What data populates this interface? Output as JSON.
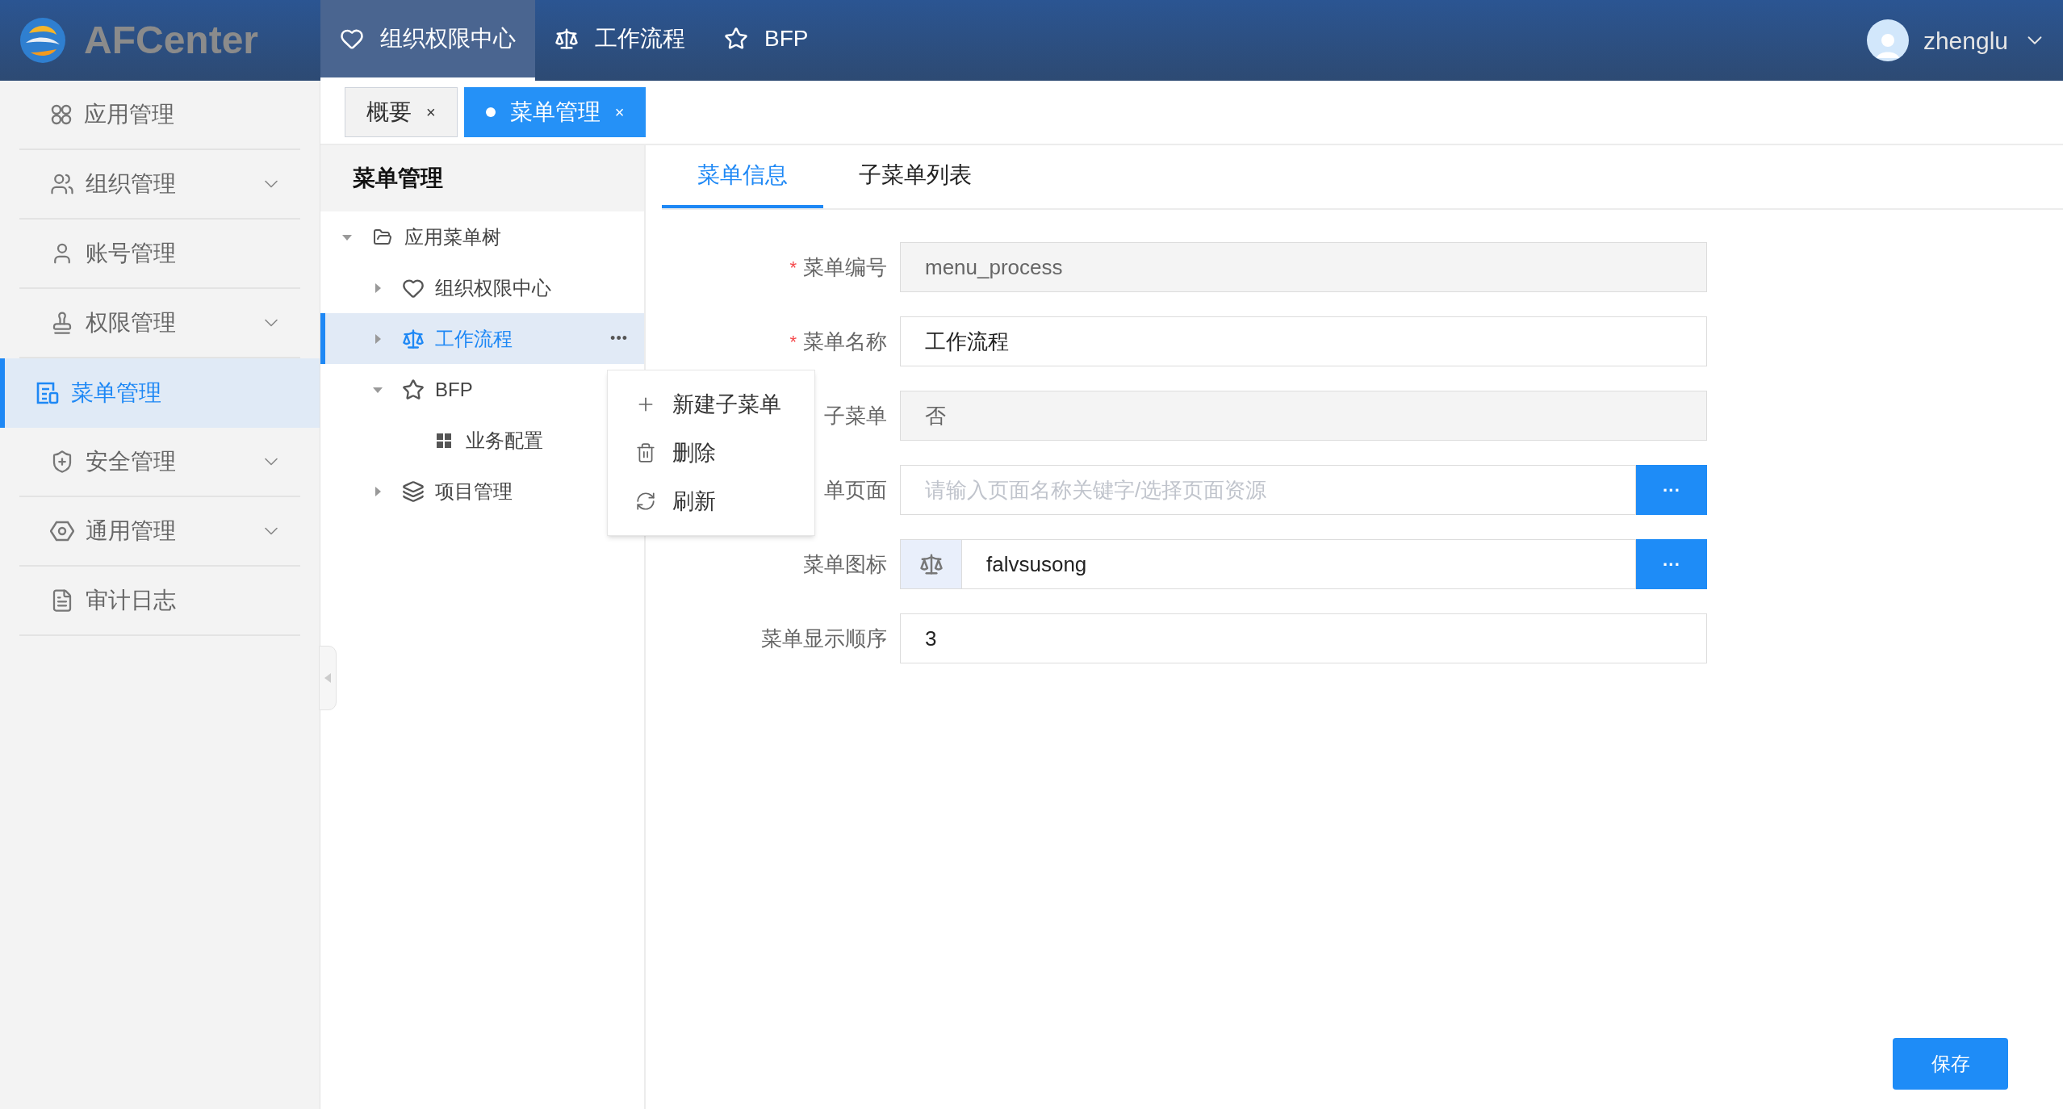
{
  "header": {
    "logo_text": "AFCenter",
    "nav": [
      {
        "label": "组织权限中心",
        "selected": true
      },
      {
        "label": "工作流程",
        "selected": false
      },
      {
        "label": "BFP",
        "selected": false
      }
    ],
    "user": {
      "name": "zhenglu"
    }
  },
  "sidebar": {
    "items": [
      {
        "label": "应用管理",
        "expandable": false,
        "selected": false
      },
      {
        "label": "组织管理",
        "expandable": true,
        "selected": false
      },
      {
        "label": "账号管理",
        "expandable": false,
        "selected": false
      },
      {
        "label": "权限管理",
        "expandable": true,
        "selected": false
      },
      {
        "label": "菜单管理",
        "expandable": false,
        "selected": true
      },
      {
        "label": "安全管理",
        "expandable": true,
        "selected": false
      },
      {
        "label": "通用管理",
        "expandable": true,
        "selected": false
      },
      {
        "label": "审计日志",
        "expandable": false,
        "selected": false
      }
    ]
  },
  "page_tabs": [
    {
      "label": "概要",
      "selected": false,
      "close": "×"
    },
    {
      "label": "菜单管理",
      "selected": true,
      "close": "×"
    }
  ],
  "tree": {
    "title": "菜单管理",
    "nodes": [
      {
        "label": "应用菜单树",
        "expanded": true,
        "selected": false,
        "children": [
          {
            "label": "组织权限中心",
            "expanded": false,
            "selected": false
          },
          {
            "label": "工作流程",
            "expanded": false,
            "selected": true,
            "more": "•••"
          },
          {
            "label": "BFP",
            "expanded": true,
            "selected": false,
            "children": [
              {
                "label": "业务配置",
                "selected": false
              }
            ]
          },
          {
            "label": "项目管理",
            "expanded": false,
            "selected": false
          }
        ]
      }
    ]
  },
  "context_menu": {
    "items": [
      {
        "label": "新建子菜单"
      },
      {
        "label": "删除"
      },
      {
        "label": "刷新"
      }
    ]
  },
  "form_tabs": [
    {
      "label": "菜单信息",
      "selected": true
    },
    {
      "label": "子菜单列表",
      "selected": false
    }
  ],
  "form": {
    "fields": [
      {
        "label": "菜单编号",
        "required": true,
        "kind": "text",
        "value": "menu_process",
        "disabled": true
      },
      {
        "label": "菜单名称",
        "required": true,
        "kind": "text",
        "value": "工作流程",
        "disabled": false
      },
      {
        "label": "子菜单",
        "required": false,
        "kind": "text",
        "value": "否",
        "disabled": true
      },
      {
        "label": "单页面",
        "required": false,
        "kind": "picker",
        "placeholder": "请输入页面名称关键字/选择页面资源",
        "button": "···"
      },
      {
        "label": "菜单图标",
        "required": false,
        "kind": "icon_picker",
        "value": "falvsusong",
        "button": "···"
      },
      {
        "label": "菜单显示顺序",
        "required": false,
        "kind": "text",
        "value": "3",
        "disabled": false
      }
    ],
    "required_mark": "*",
    "save_button": "保存"
  }
}
